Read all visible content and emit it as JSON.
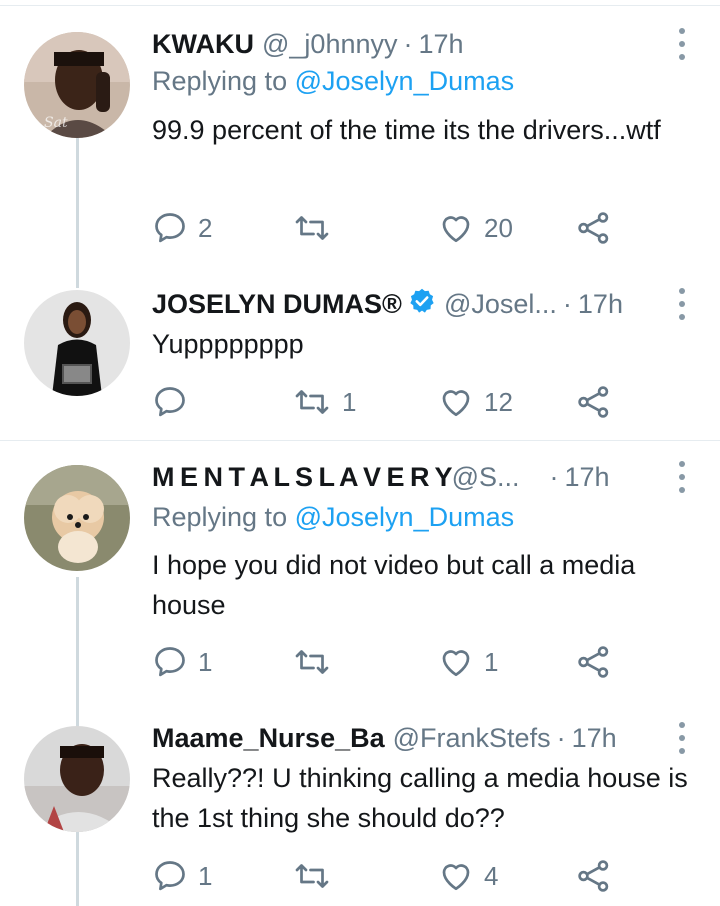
{
  "tweets": [
    {
      "name": "KWAKU",
      "handle": "@_j0hnnyy",
      "time": "17h",
      "replying_prefix": "Replying to",
      "replying_to": "@Joselyn_Dumas",
      "text": "99.9 percent of the time its the drivers...wtf",
      "replies": "2",
      "retweets": "",
      "likes": "20"
    },
    {
      "name": "JOSELYN DUMAS®",
      "handle": "@Josel...",
      "time": "17h",
      "verified": true,
      "text": "Yupppppppp",
      "replies": "",
      "retweets": "1",
      "likes": "12"
    },
    {
      "name": "M E N T A L S L A V E R Y",
      "handle": "@S...",
      "time": "17h",
      "replying_prefix": "Replying to",
      "replying_to": "@Joselyn_Dumas",
      "text": "I hope you did not video but call a media house",
      "replies": "1",
      "retweets": "",
      "likes": "1"
    },
    {
      "name": "Maame_Nurse_Ba",
      "handle": "@FrankStefs",
      "time": "17h",
      "text": "Really??! U thinking calling a media house is the 1st thing she should do??",
      "replies": "1",
      "retweets": "",
      "likes": "4"
    }
  ],
  "separator_dot": "·",
  "colors": {
    "text": "#14171a",
    "secondary": "#657786",
    "link": "#1da1f2",
    "thread_line": "#cfd9de",
    "divider": "#e6ecf0"
  },
  "icons": [
    "reply-icon",
    "retweet-icon",
    "like-icon",
    "share-icon",
    "more-icon",
    "verified-badge-icon"
  ]
}
